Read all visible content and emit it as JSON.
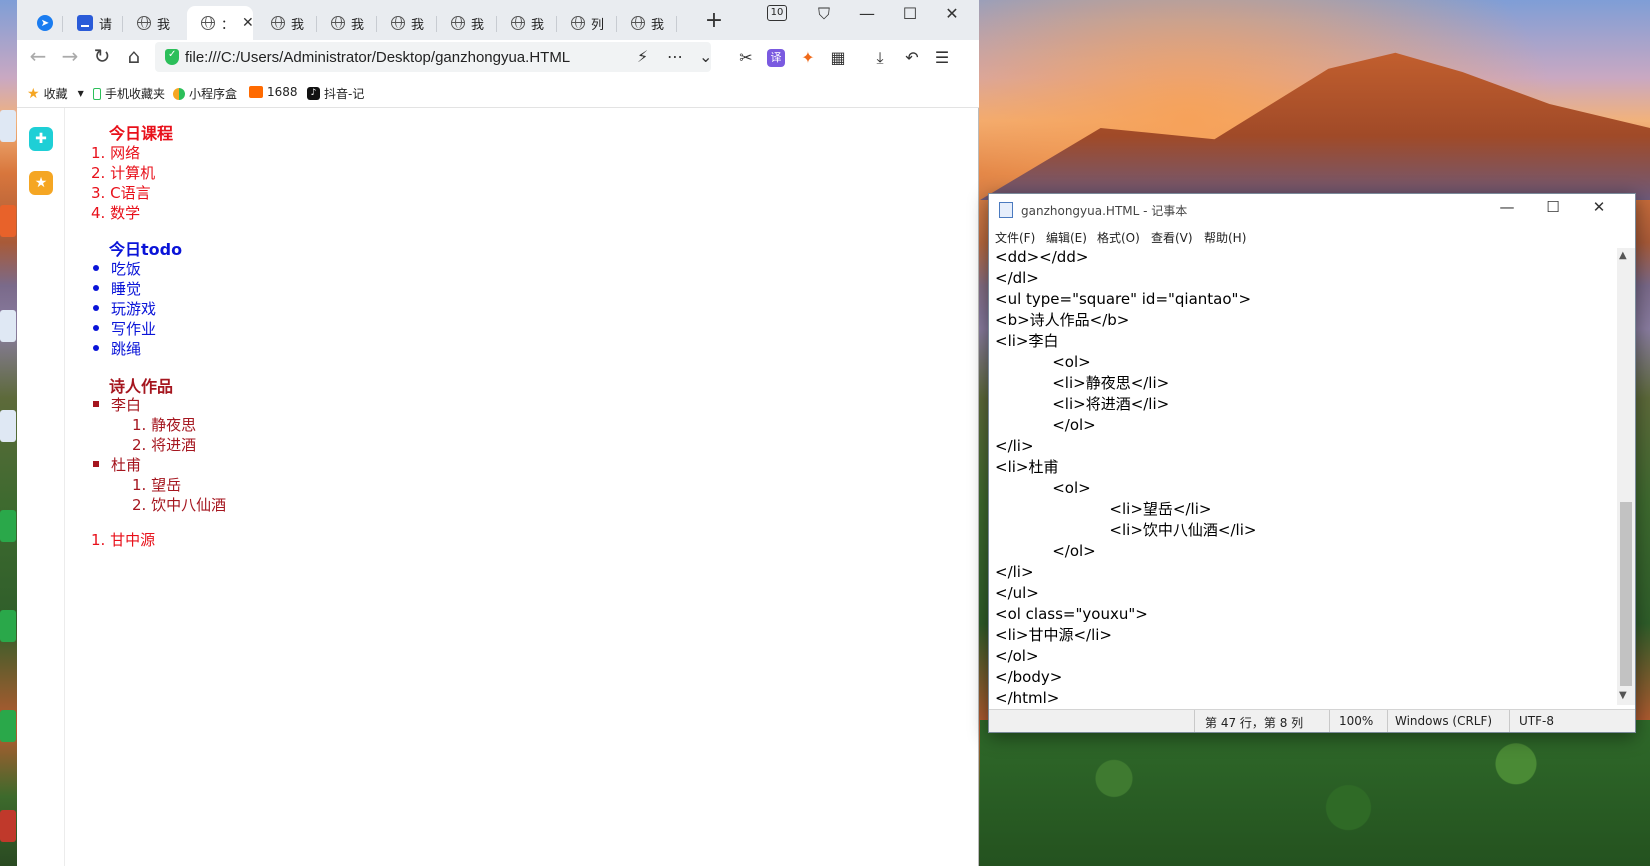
{
  "browser": {
    "tabs": [
      {
        "label": ""
      },
      {
        "label": "请"
      },
      {
        "label": "我"
      },
      {
        "label": "："
      },
      {
        "label": "我"
      },
      {
        "label": "我"
      },
      {
        "label": "我"
      },
      {
        "label": "我"
      },
      {
        "label": "我"
      },
      {
        "label": "列"
      },
      {
        "label": "我"
      }
    ],
    "tab_count_badge": "10",
    "url": "file:///C:/Users/Administrator/Desktop/ganzhongyua.HTML",
    "bookmarks": [
      {
        "label": "收藏"
      },
      {
        "label": "手机收藏夹"
      },
      {
        "label": "小程序盒"
      },
      {
        "label": "1688"
      },
      {
        "label": "抖音-记"
      }
    ]
  },
  "page": {
    "list1": {
      "title": "今日课程",
      "items": [
        "网络",
        "计算机",
        "C语言",
        "数学"
      ]
    },
    "list2": {
      "title": "今日todo",
      "items": [
        "吃饭",
        "睡觉",
        "玩游戏",
        "写作业",
        "跳绳"
      ]
    },
    "list3": {
      "title": "诗人作品",
      "poets": [
        {
          "name": "李白",
          "works": [
            "静夜思",
            "将进酒"
          ]
        },
        {
          "name": "杜甫",
          "works": [
            "望岳",
            "饮中八仙酒"
          ]
        }
      ]
    },
    "list4": {
      "items": [
        "甘中源"
      ]
    }
  },
  "notepad": {
    "title": "ganzhongyua.HTML - 记事本",
    "menu": [
      "文件(F)",
      "编辑(E)",
      "格式(O)",
      "查看(V)",
      "帮助(H)"
    ],
    "code_lines": [
      "<dd></dd>",
      "</dl>",
      "<ul type=\"square\" id=\"qiantao\">",
      "<b>诗人作品</b>",
      "<li>李白",
      "            <ol>",
      "            <li>静夜思</li>",
      "            <li>将进酒</li>",
      "            </ol>",
      "</li>",
      "<li>杜甫",
      "            <ol>",
      "                        <li>望岳</li>",
      "                        <li>饮中八仙酒</li>",
      "            </ol>",
      "</li>",
      "</ul>",
      "<ol class=\"youxu\">",
      "<li>甘中源</li>",
      "</ol>",
      "</body>",
      "</html>"
    ],
    "status": {
      "position": "第 47 行，第 8 列",
      "zoom": "100%",
      "line_ending": "Windows (CRLF)",
      "encoding": "UTF-8"
    }
  },
  "colors": {
    "list_red": "#e8101a",
    "list_blue": "#0a14d8",
    "list_dark_red": "#a5161f"
  }
}
